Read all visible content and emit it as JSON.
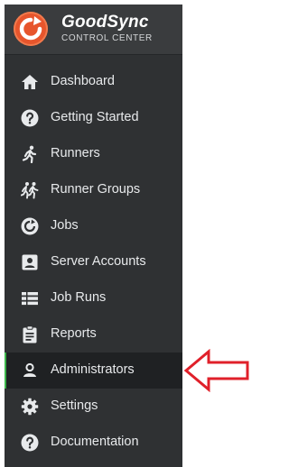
{
  "brand": {
    "name": "GoodSync",
    "subtitle": "CONTROL CENTER"
  },
  "nav": {
    "items": [
      {
        "label": "Dashboard",
        "icon": "home-icon"
      },
      {
        "label": "Getting Started",
        "icon": "help-icon"
      },
      {
        "label": "Runners",
        "icon": "runner-icon"
      },
      {
        "label": "Runner Groups",
        "icon": "runner-group-icon"
      },
      {
        "label": "Jobs",
        "icon": "sync-icon"
      },
      {
        "label": "Server Accounts",
        "icon": "account-box-icon"
      },
      {
        "label": "Job Runs",
        "icon": "list-icon"
      },
      {
        "label": "Reports",
        "icon": "clipboard-icon"
      },
      {
        "label": "Administrators",
        "icon": "person-icon",
        "active": true
      },
      {
        "label": "Settings",
        "icon": "gear-icon"
      },
      {
        "label": "Documentation",
        "icon": "help-icon"
      }
    ]
  },
  "colors": {
    "sidebar_bg": "#2f3133",
    "active_accent": "#3bb44a",
    "logo": "#e7552c",
    "annotation_arrow": "#e0202a"
  }
}
